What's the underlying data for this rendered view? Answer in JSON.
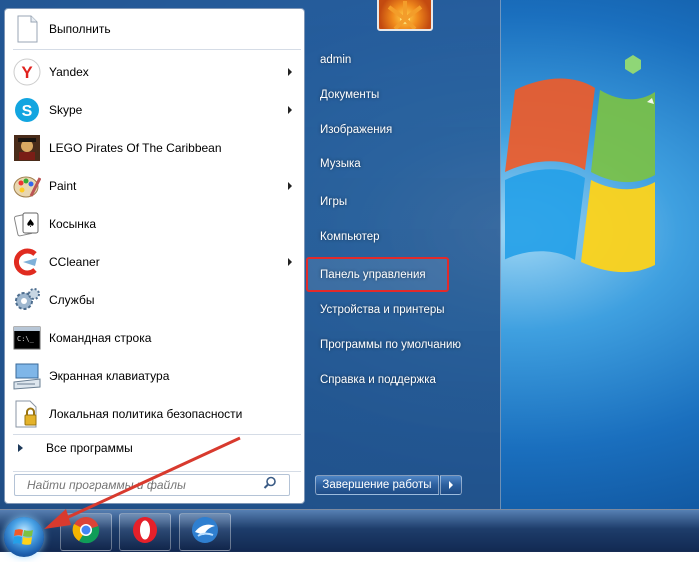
{
  "start_menu": {
    "pinned": [
      {
        "label": "Выполнить",
        "icon": "run-document-icon",
        "submenu": false
      },
      {
        "label": "Yandex",
        "icon": "yandex-browser-icon",
        "submenu": true
      },
      {
        "label": "Skype",
        "icon": "skype-icon",
        "submenu": true
      },
      {
        "label": "LEGO Pirates Of The Caribbean",
        "icon": "lego-pirates-game-icon",
        "submenu": false
      },
      {
        "label": "Paint",
        "icon": "paint-palette-icon",
        "submenu": true
      },
      {
        "label": "Косынка",
        "icon": "solitaire-cards-icon",
        "submenu": false
      },
      {
        "label": "CCleaner",
        "icon": "ccleaner-icon",
        "submenu": true
      },
      {
        "label": "Службы",
        "icon": "services-gears-icon",
        "submenu": false
      },
      {
        "label": "Командная строка",
        "icon": "command-prompt-icon",
        "submenu": false
      },
      {
        "label": "Экранная клавиатура",
        "icon": "onscreen-keyboard-icon",
        "submenu": false
      },
      {
        "label": "Локальная политика безопасности",
        "icon": "security-policy-icon",
        "submenu": false
      }
    ],
    "all_programs": "Все программы",
    "search_placeholder": "Найти программы и файлы",
    "right_pane": [
      {
        "label": "admin"
      },
      {
        "label": "Документы"
      },
      {
        "label": "Изображения"
      },
      {
        "label": "Музыка"
      },
      {
        "label": "Игры"
      },
      {
        "label": "Компьютер"
      },
      {
        "label": "Панель управления",
        "highlighted": true
      },
      {
        "label": "Устройства и принтеры"
      },
      {
        "label": "Программы по умолчанию"
      },
      {
        "label": "Справка и поддержка"
      }
    ],
    "shutdown_label": "Завершение работы"
  },
  "taskbar": {
    "start_orb": "windows-start-orb-icon",
    "pinned_apps": [
      "chrome-icon",
      "opera-icon",
      "thunderbird-icon"
    ]
  },
  "colors": {
    "highlight_border": "#e22a2a",
    "annotation_arrow": "#d83a2e",
    "desktop_blue": "#1a6fbe"
  }
}
